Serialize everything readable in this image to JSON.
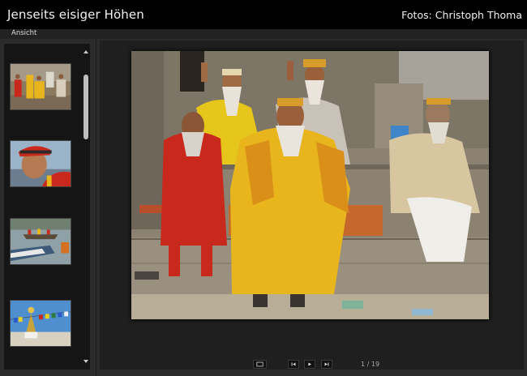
{
  "header": {
    "title": "Jenseits eisiger Höhen",
    "credit": "Fotos: Christoph Thoma"
  },
  "menu": {
    "view_label": "Ansicht"
  },
  "gallery": {
    "thumbnails": [
      {
        "subject": "group-of-sadhus"
      },
      {
        "subject": "man-in-red-cap"
      },
      {
        "subject": "boats-on-river"
      },
      {
        "subject": "stupa-with-prayer-flags"
      }
    ],
    "scroll_position": 0.1
  },
  "viewer": {
    "current": 1,
    "total": 19,
    "counter_text": "1 / 19"
  },
  "controls": {
    "icons": [
      "fullscreen-icon",
      "previous-icon",
      "play-icon",
      "next-icon"
    ]
  },
  "colors": {
    "background": "#2b2b2b",
    "header": "#000000",
    "sidebar": "#151515",
    "saffron": "#e8b61c",
    "red_robe": "#c8291c"
  }
}
